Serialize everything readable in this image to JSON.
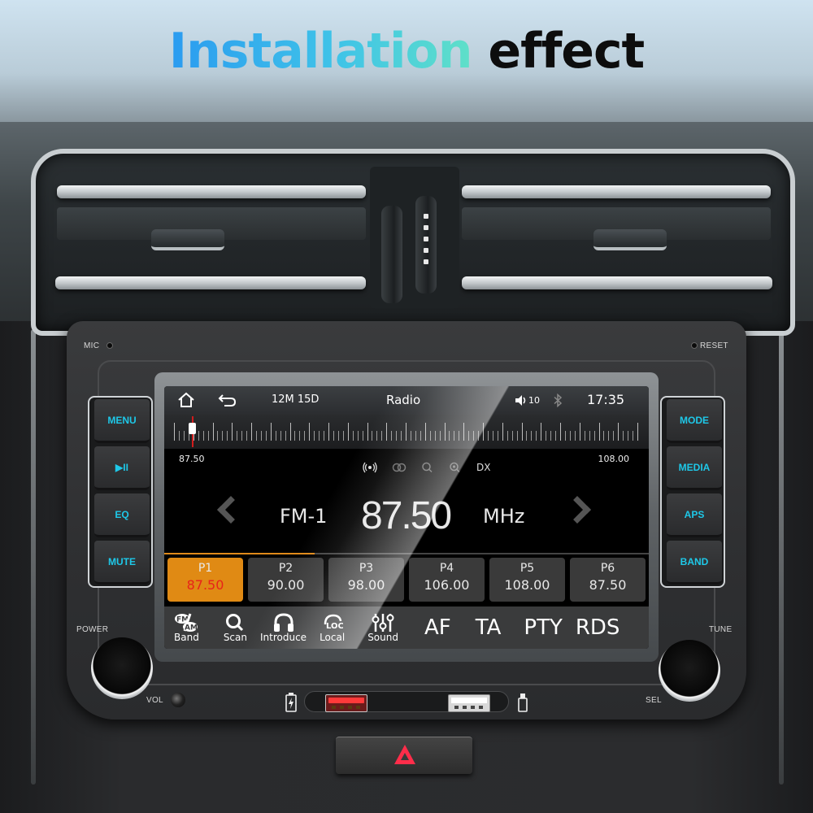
{
  "headline": {
    "gradient_part": "Installation",
    "dark_part": "effect"
  },
  "unit_labels": {
    "mic": "MIC",
    "reset": "RESET",
    "power": "POWER",
    "vol": "VOL",
    "tune": "TUNE",
    "sel": "SEL"
  },
  "left_buttons": [
    {
      "label": "MENU"
    },
    {
      "label": "▶II"
    },
    {
      "label": "EQ"
    },
    {
      "label": "MUTE"
    }
  ],
  "right_buttons": [
    {
      "label": "MODE"
    },
    {
      "label": "MEDIA"
    },
    {
      "label": "APS"
    },
    {
      "label": "BAND"
    }
  ],
  "screen": {
    "topbar": {
      "home_icon": "home-icon",
      "back_icon": "back-icon",
      "date": "12M 15D",
      "title": "Radio",
      "volume_icon": "speaker-icon",
      "volume": "10",
      "bluetooth_icon": "bluetooth-icon",
      "time": "17:35"
    },
    "tuner": {
      "min_label": "87.50",
      "max_label": "108.00",
      "min": 87.5,
      "max": 108.0,
      "current": 87.5
    },
    "status_icons": {
      "stereo_icon": "broadcast-icon",
      "st_icon": "stereo-rings-icon",
      "search_icon": "search-icon",
      "search2_icon": "search-local-icon",
      "dx": "DX"
    },
    "band": "FM-1",
    "frequency": "87.50",
    "unit": "MHz",
    "preset_progress": 0.31,
    "presets": [
      {
        "name": "P1",
        "freq": "87.50",
        "active": true
      },
      {
        "name": "P2",
        "freq": "90.00",
        "active": false
      },
      {
        "name": "P3",
        "freq": "98.00",
        "active": false
      },
      {
        "name": "P4",
        "freq": "106.00",
        "active": false
      },
      {
        "name": "P5",
        "freq": "108.00",
        "active": false
      },
      {
        "name": "P6",
        "freq": "87.50",
        "active": false
      }
    ],
    "functions": [
      {
        "label": "Band",
        "icon": "fm-am-icon",
        "glyph": "FM/AM"
      },
      {
        "label": "Scan",
        "icon": "search-icon",
        "glyph": "🔍"
      },
      {
        "label": "Introduce",
        "icon": "headphones-icon",
        "glyph": "🎧"
      },
      {
        "label": "Local",
        "icon": "loc-icon",
        "glyph": "LOC"
      },
      {
        "label": "Sound",
        "icon": "equalizer-icon",
        "glyph": "⫶"
      }
    ],
    "rds_buttons": [
      "AF",
      "TA",
      "PTY",
      "RDS"
    ]
  },
  "colors": {
    "accent_cyan": "#1ec8e8",
    "preset_active": "#e08a14",
    "preset_active_freq": "#e8231a",
    "needle": "#d21c1c",
    "hazard": "#ff2d4a"
  }
}
